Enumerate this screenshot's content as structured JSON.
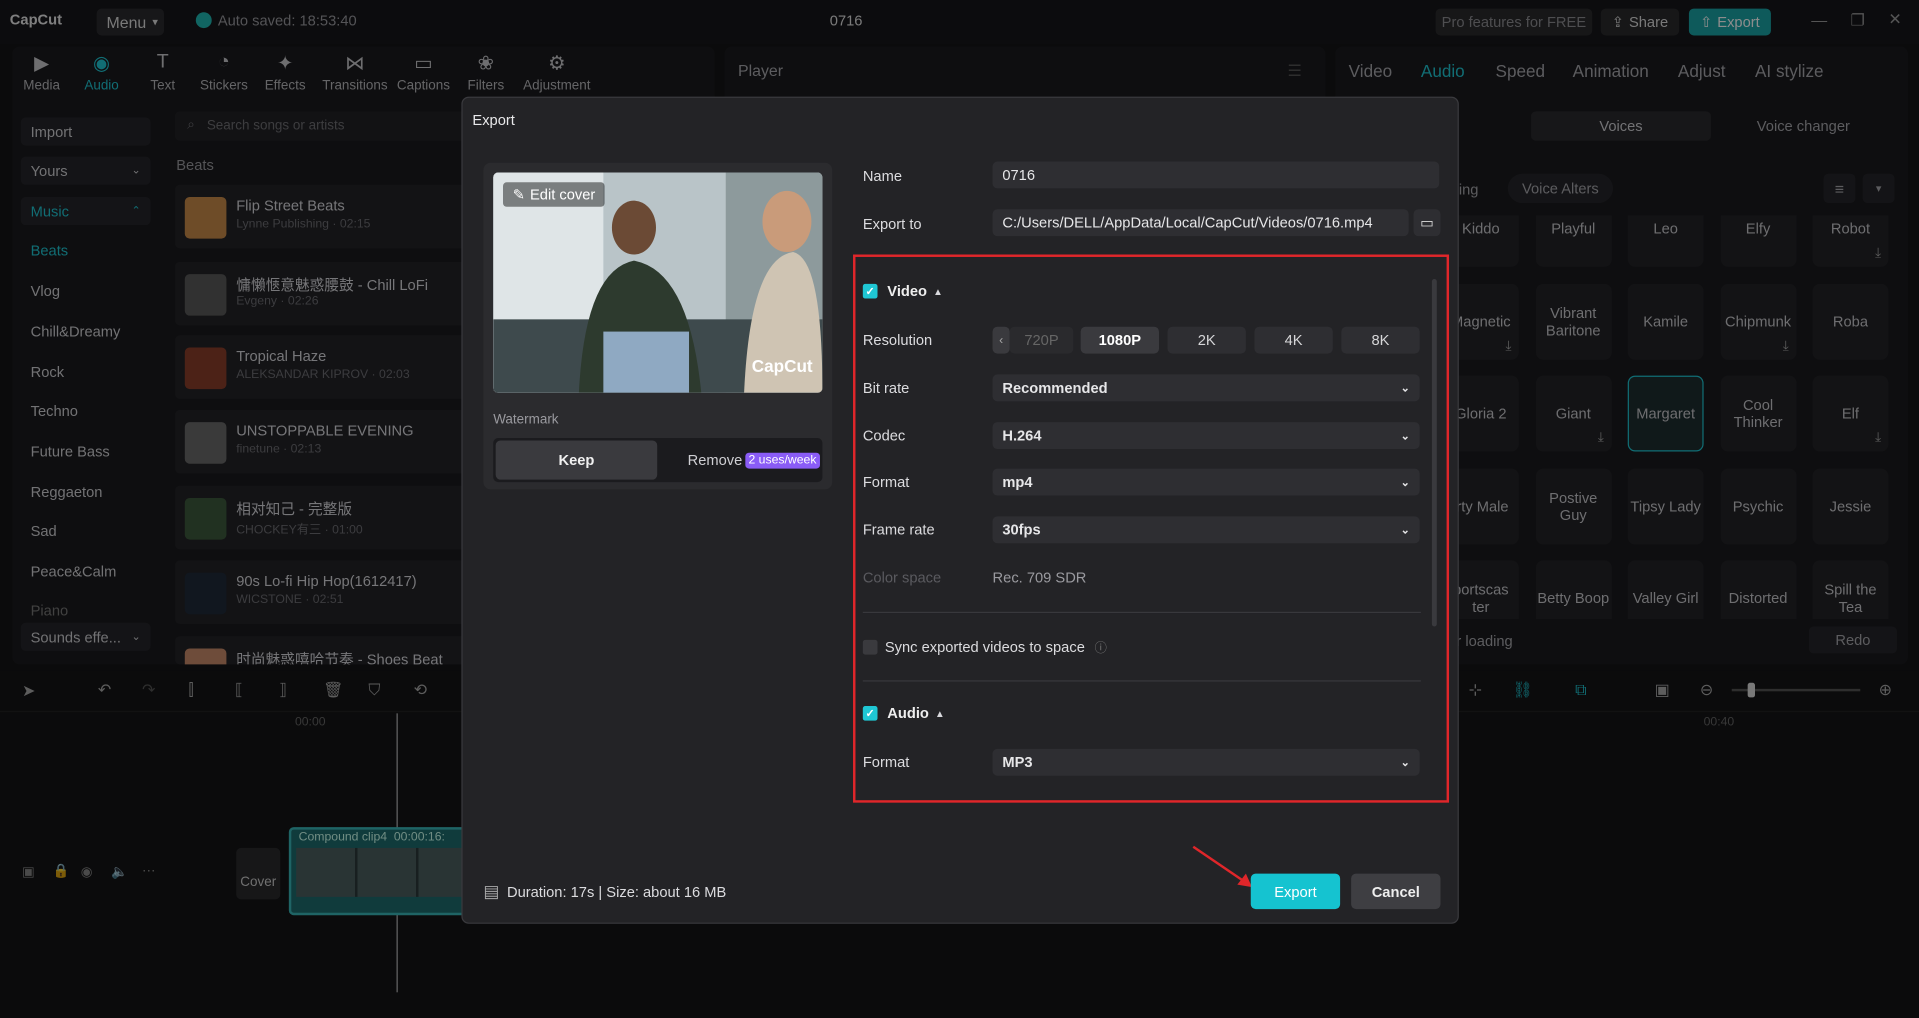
{
  "app": {
    "logo": "CapCut",
    "menu": "Menu",
    "autosave": "Auto saved: 18:53:40",
    "project_title": "0716",
    "pro_features": "Pro features for FREE",
    "share": "Share",
    "export": "Export"
  },
  "toolbar": [
    {
      "label": "Media",
      "icon": "media-icon"
    },
    {
      "label": "Audio",
      "icon": "audio-icon",
      "active": true
    },
    {
      "label": "Text",
      "icon": "text-icon"
    },
    {
      "label": "Stickers",
      "icon": "stickers-icon"
    },
    {
      "label": "Effects",
      "icon": "effects-icon"
    },
    {
      "label": "Transitions",
      "icon": "transitions-icon"
    },
    {
      "label": "Captions",
      "icon": "captions-icon"
    },
    {
      "label": "Filters",
      "icon": "filters-icon"
    },
    {
      "label": "Adjustment",
      "icon": "adjustment-icon"
    }
  ],
  "sidebar": {
    "import": "Import",
    "yours": "Yours",
    "music": "Music",
    "sounds": "Sounds effe...",
    "categories": [
      "Beats",
      "Vlog",
      "Chill&Dreamy",
      "Rock",
      "Techno",
      "Future Bass",
      "Reggaeton",
      "Sad",
      "Peace&Calm",
      "Piano"
    ]
  },
  "library": {
    "search_placeholder": "Search songs or artists",
    "section": "Beats",
    "songs": [
      {
        "title": "Flip Street Beats",
        "sub": "Lynne Publishing · 02:15"
      },
      {
        "title": "慵懶愜意魅惑腰鼓 - Chill LoFi",
        "sub": "Evgeny · 02:26"
      },
      {
        "title": "Tropical Haze",
        "sub": "ALEKSANDAR KIPROV · 02:03"
      },
      {
        "title": "UNSTOPPABLE EVENING",
        "sub": "finetune · 02:13"
      },
      {
        "title": "相对知己 - 完整版",
        "sub": "CHOCKEY有三 · 01:00"
      },
      {
        "title": "90s Lo-fi Hip Hop(1612417)",
        "sub": "WICSTONE · 02:51"
      },
      {
        "title": "时尚魅惑嘻哈节奏 - Shoes Beat",
        "sub": ""
      }
    ]
  },
  "player": {
    "title": "Player"
  },
  "right_panel": {
    "tabs": [
      "Video",
      "Audio",
      "Speed",
      "Animation",
      "Adjust",
      "AI stylize"
    ],
    "subtabs": [
      "Voices",
      "Voice changer"
    ],
    "filters": [
      "ing",
      "Voice Alters"
    ],
    "voices": [
      "Kiddo",
      "Playful",
      "Leo",
      "Elfy",
      "Robot",
      "Magnetic",
      "Vibrant Baritone",
      "Kamile",
      "Chipmunk",
      "Roba",
      "Gloria 2",
      "Giant",
      "Margaret",
      "Cool Thinker",
      "Elf",
      "irty Male",
      "Postive Guy",
      "Tipsy Lady",
      "Psychic",
      "Jessie",
      "portscas ter",
      "Betty Boop",
      "Valley Girl",
      "Distorted",
      "Spill the Tea"
    ],
    "loading": "r loading",
    "redo": "Redo"
  },
  "timeline": {
    "time_start": "00:00",
    "time_end": "00:40",
    "clip_label": "Compound clip4",
    "clip_duration": "00:00:16:",
    "cover": "Cover"
  },
  "dialog": {
    "title": "Export",
    "edit_cover": "Edit cover",
    "watermark_brand": "CapCut",
    "watermark_label": "Watermark",
    "keep": "Keep",
    "remove": "Remove",
    "uses_badge": "2 uses/week",
    "name_label": "Name",
    "name_value": "0716",
    "export_to_label": "Export to",
    "export_to_value": "C:/Users/DELL/AppData/Local/CapCut/Videos/0716.mp4",
    "video_label": "Video",
    "resolution_label": "Resolution",
    "resolutions": [
      "720P",
      "1080P",
      "2K",
      "4K",
      "8K"
    ],
    "resolution_selected": "1080P",
    "bitrate_label": "Bit rate",
    "bitrate_value": "Recommended",
    "codec_label": "Codec",
    "codec_value": "H.264",
    "format_label": "Format",
    "format_value": "mp4",
    "framerate_label": "Frame rate",
    "framerate_value": "30fps",
    "colorspace_label": "Color space",
    "colorspace_value": "Rec. 709 SDR",
    "sync_label": "Sync exported videos to space",
    "audio_label": "Audio",
    "audio_format_label": "Format",
    "audio_format_value": "MP3",
    "duration": "Duration: 17s | Size: about 16 MB",
    "export_button": "Export",
    "cancel_button": "Cancel"
  },
  "colors": {
    "accent": "#1fc7d4",
    "highlight_box": "#e0262a",
    "badge": "#8a5cf6"
  }
}
